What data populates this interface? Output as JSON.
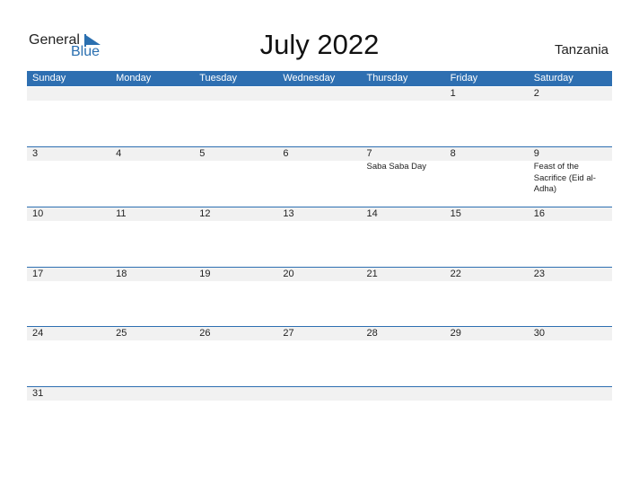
{
  "logo": {
    "general": "General",
    "blue": "Blue"
  },
  "title": "July 2022",
  "country": "Tanzania",
  "weekdays": [
    "Sunday",
    "Monday",
    "Tuesday",
    "Wednesday",
    "Thursday",
    "Friday",
    "Saturday"
  ],
  "colors": {
    "accent": "#2e6fb1",
    "strip": "#f1f1f1"
  },
  "weeks": [
    {
      "days": [
        {
          "d": ""
        },
        {
          "d": ""
        },
        {
          "d": ""
        },
        {
          "d": ""
        },
        {
          "d": ""
        },
        {
          "d": "1"
        },
        {
          "d": "2"
        }
      ]
    },
    {
      "days": [
        {
          "d": "3"
        },
        {
          "d": "4"
        },
        {
          "d": "5"
        },
        {
          "d": "6"
        },
        {
          "d": "7",
          "e": "Saba Saba Day"
        },
        {
          "d": "8"
        },
        {
          "d": "9",
          "e": "Feast of the Sacrifice (Eid al-Adha)"
        }
      ]
    },
    {
      "days": [
        {
          "d": "10"
        },
        {
          "d": "11"
        },
        {
          "d": "12"
        },
        {
          "d": "13"
        },
        {
          "d": "14"
        },
        {
          "d": "15"
        },
        {
          "d": "16"
        }
      ]
    },
    {
      "days": [
        {
          "d": "17"
        },
        {
          "d": "18"
        },
        {
          "d": "19"
        },
        {
          "d": "20"
        },
        {
          "d": "21"
        },
        {
          "d": "22"
        },
        {
          "d": "23"
        }
      ]
    },
    {
      "days": [
        {
          "d": "24"
        },
        {
          "d": "25"
        },
        {
          "d": "26"
        },
        {
          "d": "27"
        },
        {
          "d": "28"
        },
        {
          "d": "29"
        },
        {
          "d": "30"
        }
      ]
    },
    {
      "days": [
        {
          "d": "31"
        },
        {
          "d": ""
        },
        {
          "d": ""
        },
        {
          "d": ""
        },
        {
          "d": ""
        },
        {
          "d": ""
        },
        {
          "d": ""
        }
      ]
    }
  ]
}
